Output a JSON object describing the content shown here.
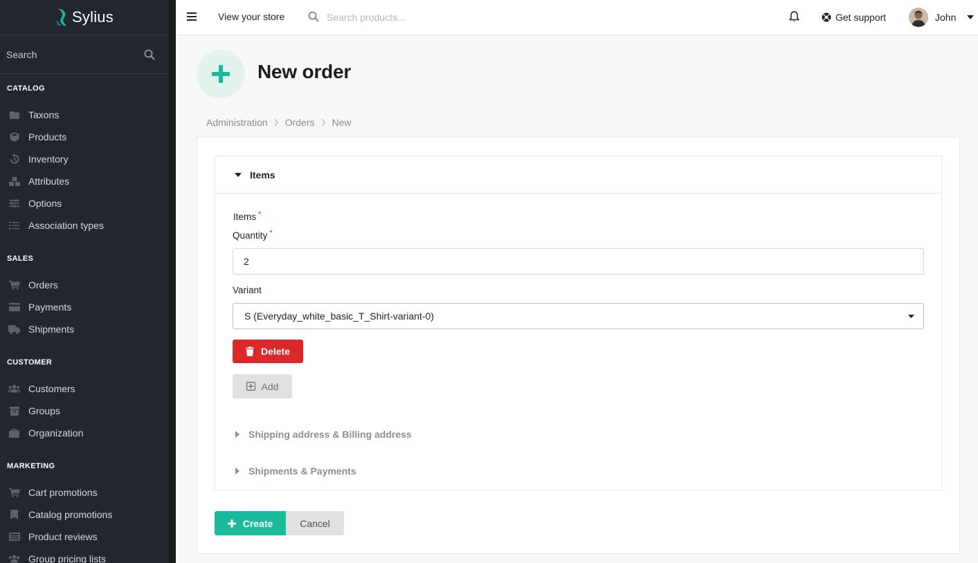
{
  "app": {
    "brand": "Sylius"
  },
  "sidebar": {
    "search_label": "Search",
    "sections": {
      "catalog": "CATALOG",
      "sales": "SALES",
      "customer": "CUSTOMER",
      "marketing": "MARKETING"
    },
    "items": {
      "taxons": "Taxons",
      "products": "Products",
      "inventory": "Inventory",
      "attributes": "Attributes",
      "options": "Options",
      "association_types": "Association types",
      "orders": "Orders",
      "payments": "Payments",
      "shipments": "Shipments",
      "customers": "Customers",
      "groups": "Groups",
      "organization": "Organization",
      "cart_promotions": "Cart promotions",
      "catalog_promotions": "Catalog promotions",
      "product_reviews": "Product reviews",
      "group_pricing_lists": "Group pricing lists"
    }
  },
  "topbar": {
    "view_store": "View your store",
    "search_placeholder": "Search products...",
    "support": "Get support",
    "user_name": "John"
  },
  "header": {
    "title": "New order",
    "breadcrumb": [
      "Administration",
      "Orders",
      "New"
    ]
  },
  "form": {
    "items_section": "Items",
    "items_label": "Items",
    "quantity_label": "Quantity",
    "quantity_value": "2",
    "variant_label": "Variant",
    "variant_value": "S (Everyday_white_basic_T_Shirt-variant-0)",
    "delete_label": "Delete",
    "add_label": "Add",
    "addresses_section": "Shipping address & Billing address",
    "shipments_section": "Shipments & Payments",
    "required_mark": "*"
  },
  "actions": {
    "create": "Create",
    "cancel": "Cancel"
  },
  "colors": {
    "accent": "#1abb9c",
    "danger": "#db2828",
    "sidebar_bg": "#22262e"
  }
}
